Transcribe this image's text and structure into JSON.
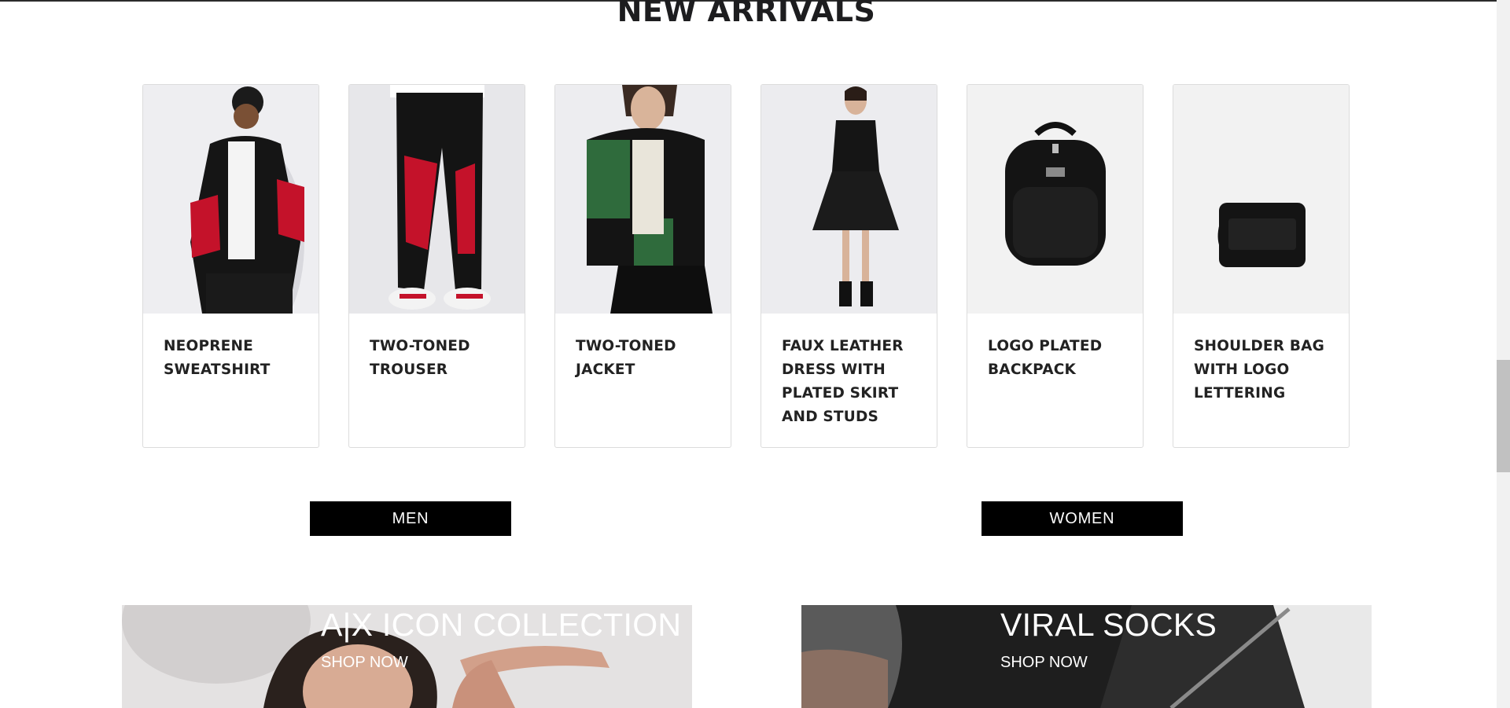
{
  "section": {
    "title": "NEW ARRIVALS"
  },
  "products": [
    {
      "name": "NEOPRENE SWEATSHIRT",
      "image_icon": "model-red-black-sweatshirt"
    },
    {
      "name": "TWO-TONED TROUSER",
      "image_icon": "red-black-trousers"
    },
    {
      "name": "TWO-TONED JACKET",
      "image_icon": "green-black-jacket"
    },
    {
      "name": "FAUX LEATHER DRESS WITH PLATED SKIRT AND STUDS",
      "image_icon": "black-dress"
    },
    {
      "name": "LOGO PLATED BACKPACK",
      "image_icon": "black-backpack"
    },
    {
      "name": "SHOULDER BAG WITH LOGO LETTERING",
      "image_icon": "black-shoulder-bag"
    }
  ],
  "categories": {
    "men_label": "MEN",
    "women_label": "WOMEN"
  },
  "banners": [
    {
      "title": "A|X ICON COLLECTION",
      "link": "SHOP NOW"
    },
    {
      "title": "VIRAL SOCKS",
      "link": "SHOP NOW"
    }
  ],
  "colors": {
    "button_bg": "#000000",
    "button_text": "#ffffff",
    "card_border": "#dcdcdc",
    "title_text": "#1d1d1f"
  }
}
